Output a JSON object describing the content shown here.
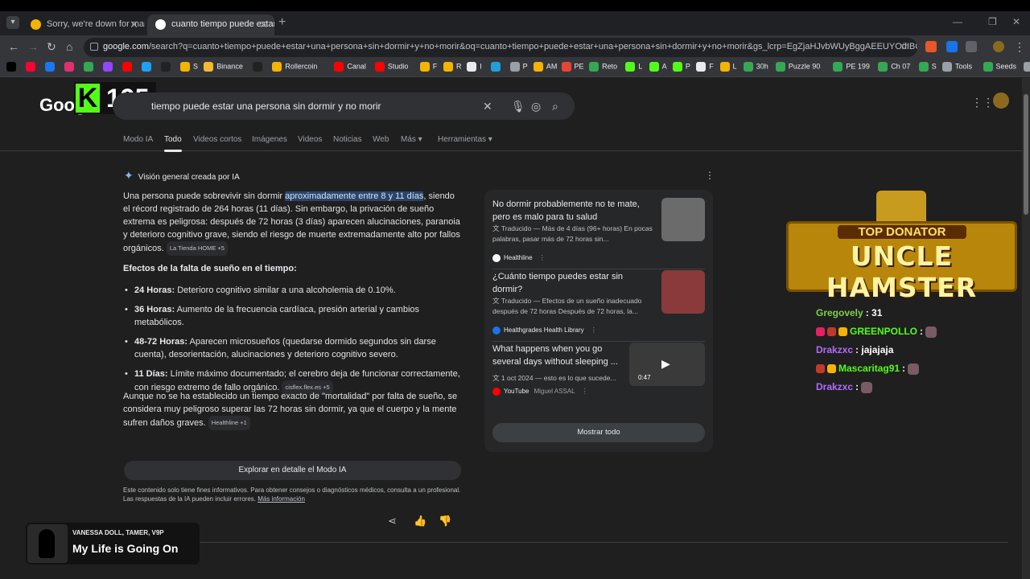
{
  "browser": {
    "tabs": [
      {
        "label": "Sorry, we're down for maintena",
        "active": false
      },
      {
        "label": "cuanto tiempo puede estar una",
        "active": true
      }
    ],
    "url_host": "google.com",
    "url_path": "/search?q=cuanto+tiempo+puede+estar+una+persona+sin+dormir+y+no+morir&oq=cuanto+tiempo+puede+estar+una+persona+sin+dormir+y+no+morir&gs_lcrp=EgZjaHJvbWUyBggAEEUYOdIBCDQ4NDhqMGo3qAIAs...",
    "bookmarks": [
      {
        "label": "",
        "color": "#000"
      },
      {
        "label": "",
        "color": "#ff0033"
      },
      {
        "label": "",
        "color": "#1877f2"
      },
      {
        "label": "",
        "color": "#e1306c"
      },
      {
        "label": "",
        "color": "#34a853"
      },
      {
        "label": "",
        "color": "#9146ff"
      },
      {
        "label": "",
        "color": "#ff0000"
      },
      {
        "label": "",
        "color": "#1da1f2"
      },
      {
        "label": "",
        "color": "#222"
      },
      {
        "label": "S",
        "color": "#f4b400"
      },
      {
        "label": "Binance",
        "color": "#f3ba2f"
      },
      {
        "label": "",
        "color": "#222"
      },
      {
        "label": "Rollercoin",
        "color": "#f4b400"
      },
      {
        "label": "Canal",
        "color": "#ff0000"
      },
      {
        "label": "Studio",
        "color": "#ff0000"
      },
      {
        "label": "F",
        "color": "#f4b400"
      },
      {
        "label": "R",
        "color": "#f4b400"
      },
      {
        "label": "I",
        "color": "#e8eaed"
      },
      {
        "label": "",
        "color": "#229ed9"
      },
      {
        "label": "P",
        "color": "#9aa0a6"
      },
      {
        "label": "AM",
        "color": "#f4b400"
      },
      {
        "label": "PE",
        "color": "#ea4335"
      },
      {
        "label": "Reto",
        "color": "#34a853"
      },
      {
        "label": "L",
        "color": "#53fc18"
      },
      {
        "label": "A",
        "color": "#53fc18"
      },
      {
        "label": "P",
        "color": "#53fc18"
      },
      {
        "label": "F",
        "color": "#e8eaed"
      },
      {
        "label": "L",
        "color": "#f4b400"
      },
      {
        "label": "30h",
        "color": "#34a853"
      },
      {
        "label": "Puzzle 90",
        "color": "#34a853"
      },
      {
        "label": "PE 199",
        "color": "#34a853"
      },
      {
        "label": "Ch 07",
        "color": "#34a853"
      },
      {
        "label": "S",
        "color": "#34a853"
      },
      {
        "label": "Tools",
        "color": "#9aa0a6"
      },
      {
        "label": "Seeds",
        "color": "#34a853"
      },
      {
        "label": "Stream",
        "color": "#9aa0a6"
      }
    ]
  },
  "google": {
    "logo": "Goog",
    "search_query": "tiempo puede estar una persona sin dormir y no morir",
    "nav_tabs": [
      "Modo IA",
      "Todo",
      "Videos cortos",
      "Imágenes",
      "Videos",
      "Noticias",
      "Web",
      "Más ▾",
      "Herramientas ▾"
    ]
  },
  "kick_overlay": {
    "k": "K",
    "count": "195"
  },
  "ai_overview": {
    "header": "Visión general creada por IA",
    "intro_before": "Una persona puede sobrevivir sin dormir ",
    "intro_highlight": "aproximadamente entre 8 y 11 días",
    "intro_after": ", siendo el récord registrado de 264 horas (11 días). Sin embargo, la privación de sueño extrema es peligrosa: después de 72 horas (3 días) aparecen alucinaciones, paranoia y deterioro cognitivo grave, siendo el riesgo de muerte extremadamente alto por fallos orgánicos. ",
    "intro_chip": "La Tienda HOME +5",
    "effects_heading": "Efectos de la falta de sueño en el tiempo:",
    "effects": [
      {
        "label": "24 Horas:",
        "text": " Deterioro cognitivo similar a una alcoholemia de 0.10%.",
        "chip": ""
      },
      {
        "label": "36 Horas:",
        "text": " Aumento de la frecuencia cardíaca, presión arterial y cambios metabólicos.",
        "chip": ""
      },
      {
        "label": "48-72 Horas:",
        "text": " Aparecen microsueños (quedarse dormido segundos sin darse cuenta), desorientación, alucinaciones y deterioro cognitivo severo.",
        "chip": ""
      },
      {
        "label": "11 Días:",
        "text": " Límite máximo documentado; el cerebro deja de funcionar correctamente, con riesgo extremo de fallo orgánico. ",
        "chip": "cisflex.flex.es +5"
      }
    ],
    "closing": "Aunque no se ha establecido un tiempo exacto de \"mortalidad\" por falta de sueño, se considera muy peligroso superar las 72 horas sin dormir, ya que el cuerpo y la mente sufren daños graves. ",
    "closing_chip": "Healthline +1",
    "explore_button": "Explorar en detalle el Modo IA",
    "disclaimer": "Este contenido solo tiene fines informativos. Para obtener consejos o diagnósticos médicos, consulta a un profesional. Las respuestas de la IA pueden incluir errores. ",
    "disclaimer_link": "Más información"
  },
  "sources": [
    {
      "title": "No dormir probablemente no te mate, pero es malo para tu salud",
      "desc": "Traducido — Más de 4 días (96+ horas) En pocas palabras, pasar más de 72 horas sin...",
      "site": "Healthline",
      "meta": "",
      "thumb_color": "#6b6b6b"
    },
    {
      "title": "¿Cuánto tiempo puedes estar sin dormir?",
      "desc": "Traducido — Efectos de un sueño inadecuado después de 72 horas Después de 72 horas, la...",
      "site": "Healthgrades Health Library",
      "meta": "",
      "thumb_color": "#8a3a3a"
    },
    {
      "title": "What happens when you go several days without sleeping ...",
      "desc": "1 oct 2024 — esto es lo que sucede...",
      "site": "YouTube",
      "meta": "Miguel ASSAL",
      "thumb_color": "#3a3a3a",
      "duration": "0:47"
    }
  ],
  "show_all": "Mostrar todo",
  "donator": {
    "label": "TOP DONATOR",
    "name": "UNCLE HAMSTER"
  },
  "chat": [
    {
      "user": "Gregovely",
      "color": "#7bd148",
      "msg": "31",
      "badges": [],
      "emote": false
    },
    {
      "user": "GREENPOLLO",
      "color": "#53fc18",
      "msg": "",
      "badges": [
        "#e91e63",
        "#c0392b",
        "#f4b400"
      ],
      "emote": true
    },
    {
      "user": "Drakzxc",
      "color": "#b36bff",
      "msg": "jajajaja",
      "badges": [],
      "emote": false
    },
    {
      "user": "Mascaritag91",
      "color": "#53fc18",
      "msg": "",
      "badges": [
        "#c0392b",
        "#f4b400"
      ],
      "emote": true
    },
    {
      "user": "Drakzxc",
      "color": "#b36bff",
      "msg": "",
      "badges": [],
      "emote": true
    }
  ],
  "now_playing": {
    "artist": "VANESSA DOLL, TAMER, V9P",
    "title": "My Life is Going On"
  }
}
